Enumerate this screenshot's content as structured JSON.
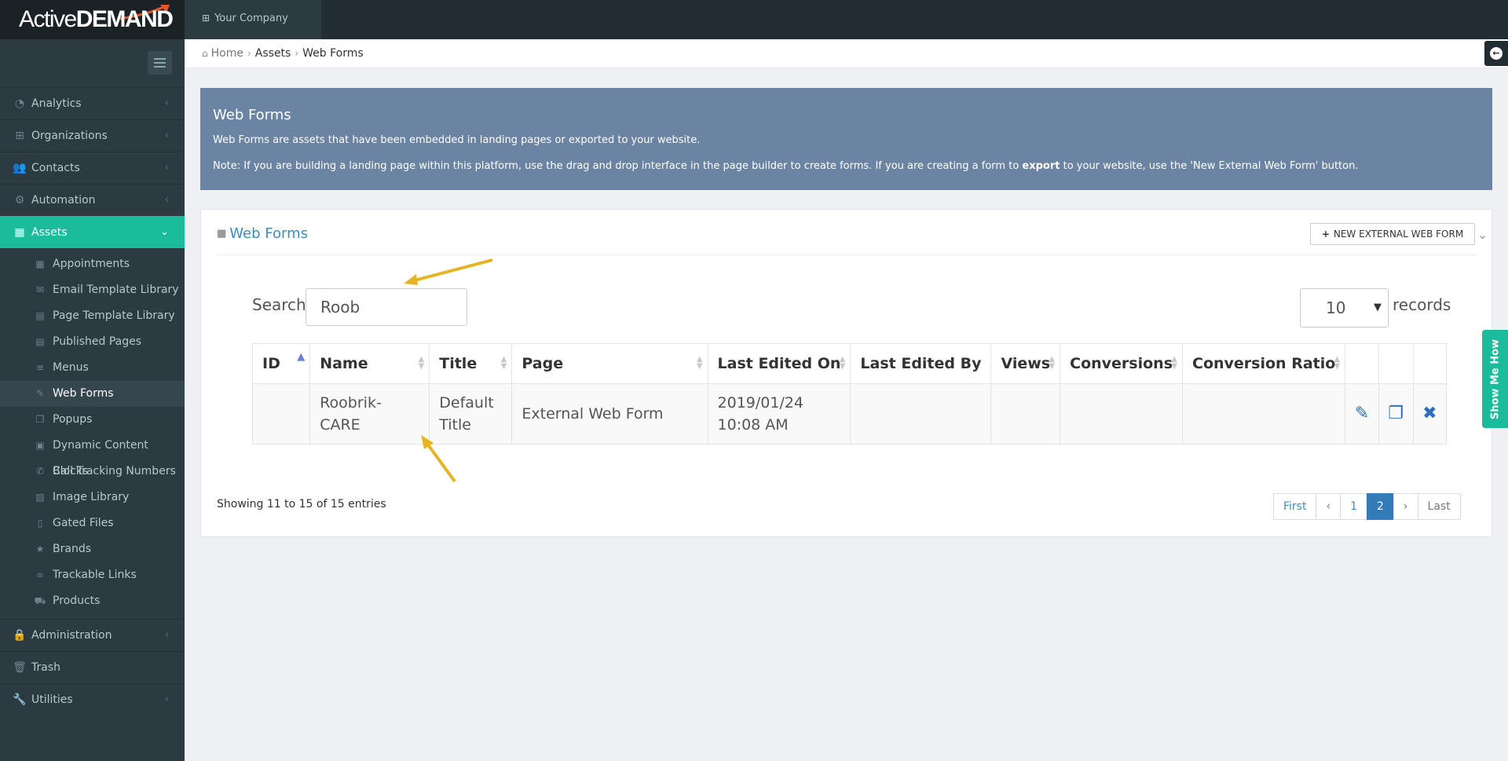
{
  "brand": {
    "logo_light": "Active",
    "logo_bold": "DEMAND",
    "accent": "#e8552a"
  },
  "topbar": {
    "company": "Your Company"
  },
  "sidebar": {
    "items": [
      {
        "label": "Analytics",
        "icon": "dashboard-icon"
      },
      {
        "label": "Organizations",
        "icon": "sitemap-icon"
      },
      {
        "label": "Contacts",
        "icon": "users-icon"
      },
      {
        "label": "Automation",
        "icon": "gears-icon"
      },
      {
        "label": "Assets",
        "icon": "grid-icon"
      }
    ],
    "sub_items": [
      "Appointments",
      "Email Template Library",
      "Page Template Library",
      "Published Pages",
      "Menus",
      "Web Forms",
      "Popups",
      "Dynamic Content Blocks",
      "Call Tracking Numbers",
      "Image Library",
      "Gated Files",
      "Brands",
      "Trackable Links",
      "Products"
    ],
    "bottom_items": [
      {
        "label": "Administration",
        "icon": "lock-icon"
      },
      {
        "label": "Trash",
        "icon": "trash-icon"
      },
      {
        "label": "Utilities",
        "icon": "wrench-icon"
      }
    ]
  },
  "breadcrumb": {
    "home": "Home",
    "assets": "Assets",
    "current": "Web Forms"
  },
  "info": {
    "title": "Web Forms",
    "line1": "Web Forms are assets that have been embedded in landing pages or exported to your website.",
    "line2_a": "Note: If you are building a landing page within this platform, use the drag and drop interface in the page builder to create forms. If you are creating a form to ",
    "line2_bold": "export",
    "line2_b": " to your website, use the 'New External Web Form' button."
  },
  "panel": {
    "title": "Web Forms",
    "new_button": "NEW EXTERNAL WEB FORM",
    "search_label": "Search:",
    "search_value": "Roob",
    "page_length": "10",
    "records_label": "records",
    "columns": [
      "ID",
      "Name",
      "Title",
      "Page",
      "Last Edited On",
      "Last Edited By",
      "Views",
      "Conversions",
      "Conversion Ratio"
    ],
    "rows": [
      {
        "id": "",
        "name": "Roobrik-CARE",
        "title": "Default Title",
        "page": "External Web Form",
        "edited_on_date": "2019/01/24",
        "edited_on_time": "10:08 AM",
        "edited_by": "",
        "views": "",
        "conversions": "",
        "ratio": ""
      }
    ],
    "showing": "Showing 11 to 15 of 15 entries",
    "pager": {
      "first": "First",
      "prev": "‹",
      "p1": "1",
      "p2": "2",
      "next": "›",
      "last": "Last"
    }
  },
  "show_me_how": "Show Me How"
}
